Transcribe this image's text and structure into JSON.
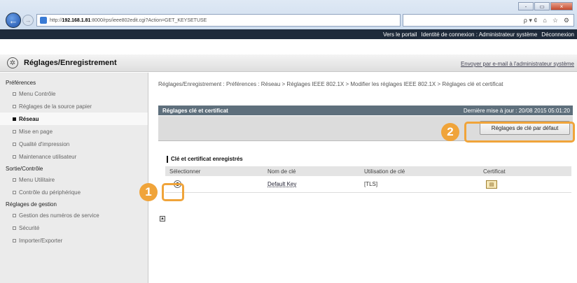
{
  "browser": {
    "url_prefix": "http://",
    "url_host": "192.168.1.81",
    "url_rest": ":8000/rps/ieee802edit.cgi?Action=GET_KEYSETUSE",
    "search_label": "ρ ▾ ¢",
    "window_buttons": [
      "-",
      "▭",
      "×"
    ]
  },
  "portal": {
    "blurred_left": "",
    "links": [
      "Vers le portail",
      "Identité de connexion : Administrateur système",
      "Déconnexion"
    ]
  },
  "header": {
    "title": "Réglages/Enregistrement",
    "email_link": "Envoyer par e-mail à l'administrateur système"
  },
  "sidebar": {
    "sections": [
      {
        "title": "Préférences",
        "items": [
          "Menu Contrôle",
          "Réglages de la source papier",
          "Réseau",
          "Mise en page",
          "Qualité d'impression",
          "Maintenance utilisateur"
        ]
      },
      {
        "title": "Sortie/Contrôle",
        "items": [
          "Menu Utilitaire",
          "Contrôle du périphérique"
        ]
      },
      {
        "title": "Réglages de gestion",
        "items": [
          "Gestion des numéros de service",
          "Sécurité",
          "Importer/Exporter"
        ]
      }
    ]
  },
  "main": {
    "breadcrumb": "Réglages/Enregistrement : Préférences : Réseau > Réglages IEEE 802.1X > Modifier les réglages IEEE 802.1X > Réglages clé et certificat",
    "panel_title": "Réglages clé et certificat",
    "last_update": "Dernière mise à jour : 20/08 2015 05:01:20",
    "default_button": "Réglages de clé par défaut",
    "section_title": "Clé et certificat enregistrés",
    "columns": [
      "Sélectionner",
      "Nom de clé",
      "Utilisation de clé",
      "Certificat"
    ],
    "rows": [
      {
        "key_name": "Default Key",
        "usage": "[TLS]"
      }
    ]
  },
  "callouts": [
    "1",
    "2"
  ],
  "colors": {
    "callout": "#f0a43a",
    "panel_header": "#5e6f7c",
    "portal_bar": "#1e2a3a"
  },
  "icons": [
    "back-arrow-icon",
    "forward-arrow-icon",
    "gear-icon",
    "certificate-icon",
    "radio-selected-icon"
  ]
}
